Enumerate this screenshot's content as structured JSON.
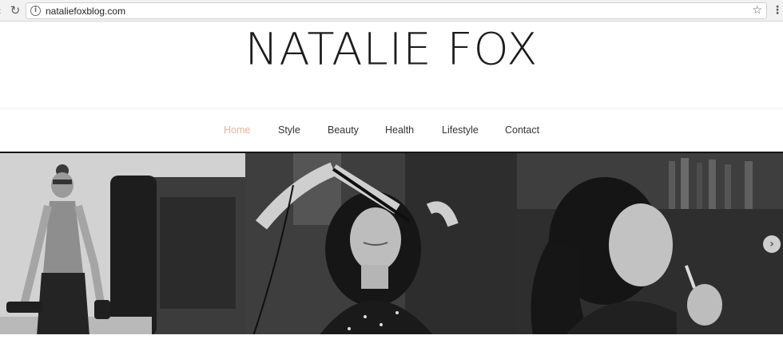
{
  "browser": {
    "url": "nataliefoxblog.com",
    "icons": [
      "back-arrow-icon",
      "reload-icon",
      "info-icon",
      "star-icon",
      "menu-kebab-icon"
    ]
  },
  "site": {
    "logo": "NATALIE FOX"
  },
  "nav": {
    "items": [
      {
        "label": "Home",
        "active": true
      },
      {
        "label": "Style",
        "active": false
      },
      {
        "label": "Beauty",
        "active": false
      },
      {
        "label": "Health",
        "active": false
      },
      {
        "label": "Lifestyle",
        "active": false
      },
      {
        "label": "Contact",
        "active": false
      }
    ],
    "active_color": "#e4b49a"
  },
  "slider": {
    "icons": [
      "next-arrow-icon"
    ]
  }
}
